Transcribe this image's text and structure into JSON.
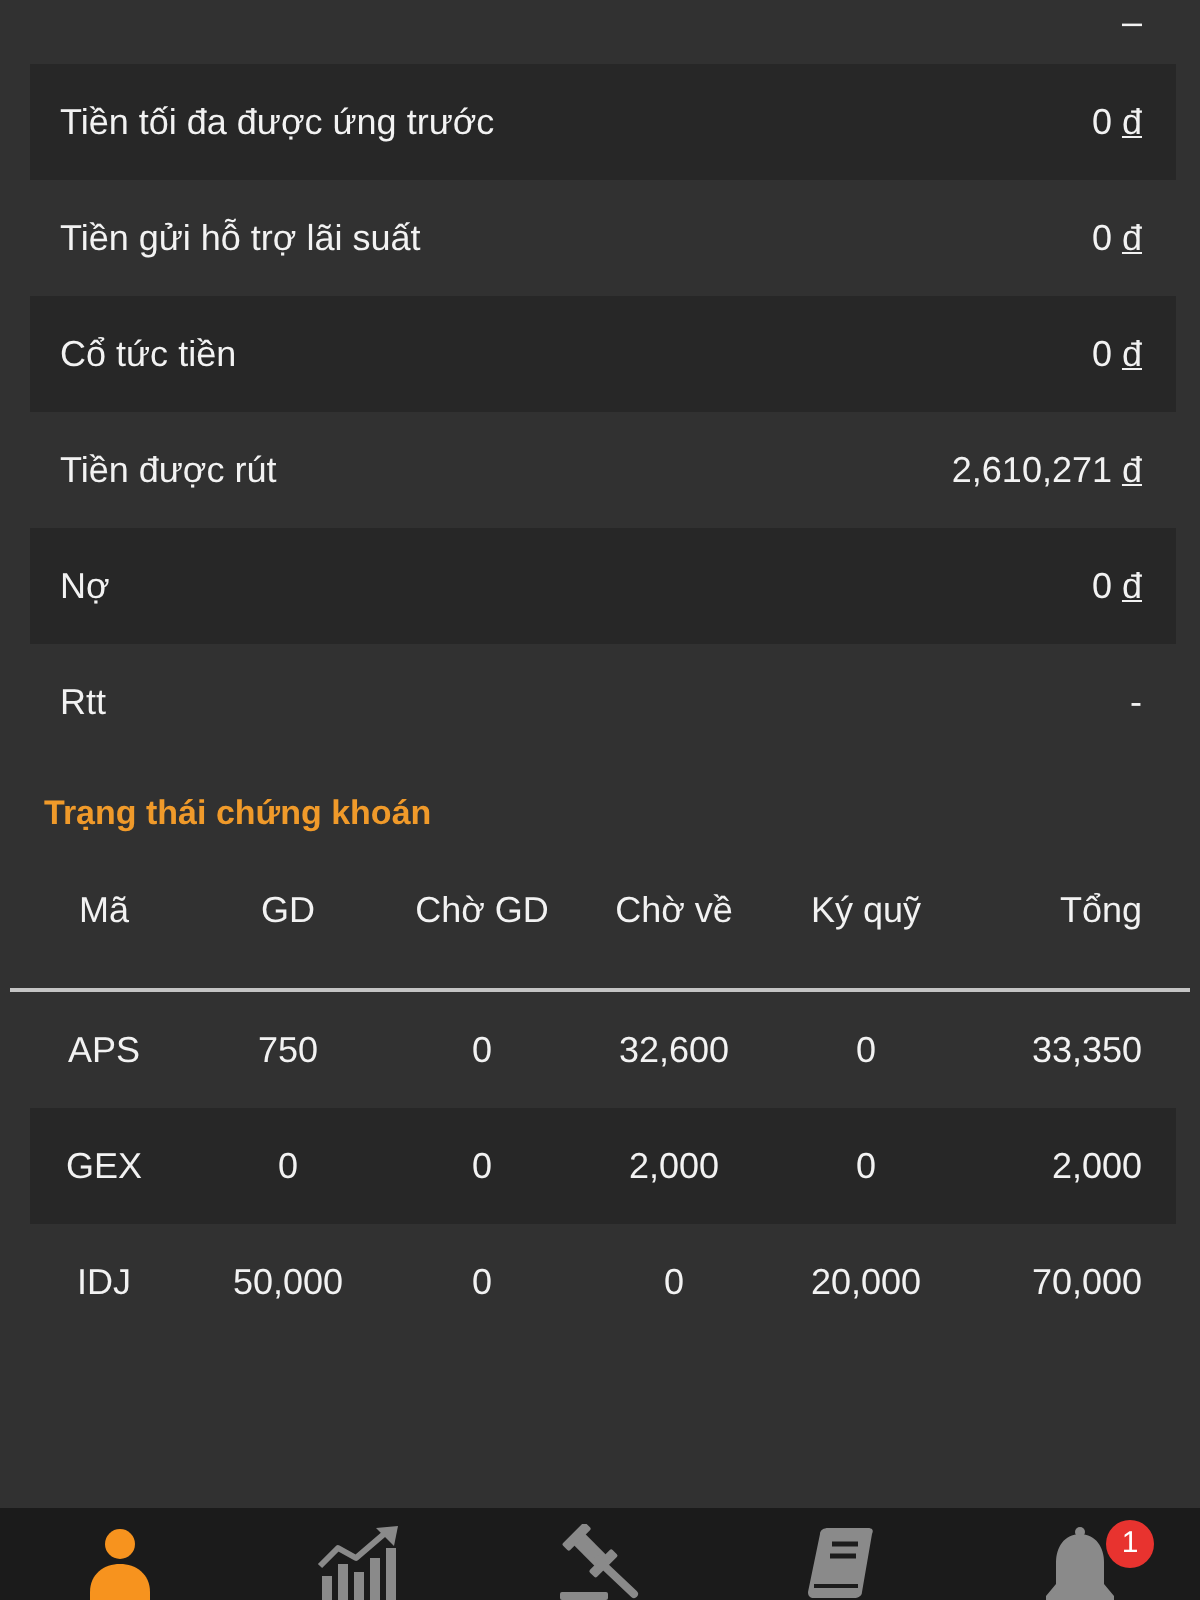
{
  "account_rows": [
    {
      "value": "–"
    },
    {
      "label": "Tiền tối đa được ứng trước",
      "value": "0",
      "currency": "đ"
    },
    {
      "label": "Tiền gửi hỗ trợ lãi suất",
      "value": "0",
      "currency": "đ"
    },
    {
      "label": "Cổ tức tiền",
      "value": "0",
      "currency": "đ"
    },
    {
      "label": "Tiền được rút",
      "value": "2,610,271",
      "currency": "đ"
    },
    {
      "label": "Nợ",
      "value": "0",
      "currency": "đ"
    },
    {
      "label": "Rtt",
      "value": "-"
    }
  ],
  "securities": {
    "title": "Trạng thái chứng khoán",
    "columns": [
      "Mã",
      "GD",
      "Chờ GD",
      "Chờ về",
      "Ký quỹ",
      "Tổng"
    ],
    "rows": [
      [
        "APS",
        "750",
        "0",
        "32,600",
        "0",
        "33,350"
      ],
      [
        "GEX",
        "0",
        "0",
        "2,000",
        "0",
        "2,000"
      ],
      [
        "IDJ",
        "50,000",
        "0",
        "0",
        "20,000",
        "70,000"
      ]
    ]
  },
  "bottom_nav": [
    {
      "kind": "person",
      "selected": true
    },
    {
      "kind": "chart",
      "selected": false
    },
    {
      "kind": "gavel",
      "selected": false
    },
    {
      "kind": "book",
      "selected": false
    },
    {
      "kind": "bell",
      "selected": false,
      "badge": "1"
    }
  ]
}
